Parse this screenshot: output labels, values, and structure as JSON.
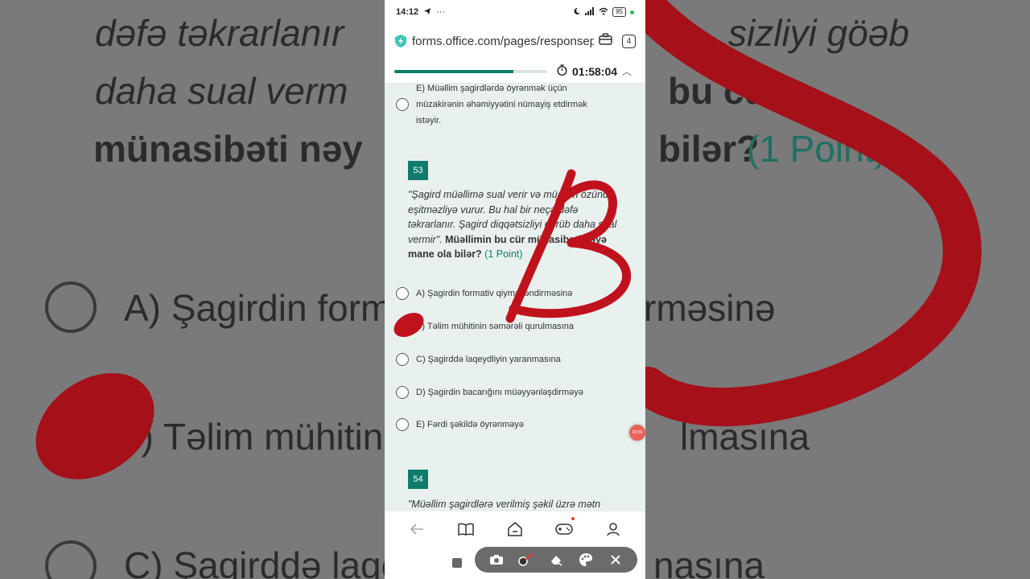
{
  "background_zoom": {
    "line1": "dəfə təkrarlanır",
    "line1b": "sizliyi göəb",
    "line2": "daha sual verm",
    "line2b": "bu cür",
    "line3": "münasibəti nəy",
    "line3b": "bilər?",
    "line3_points": "(1 Point)",
    "optionA": "A) Şagirdin form",
    "optionA_tail": "rməsinə",
    "optionB": "3) Təlim mühitin",
    "optionB_tail": "lmasına",
    "optionC": "C) Şagirddə laqe",
    "optionC_tail": "nasına"
  },
  "status_bar": {
    "time": "14:12",
    "more": "···",
    "battery": "95"
  },
  "browser": {
    "url": "forms.office.com/pages/responsepage",
    "tab_count": "4"
  },
  "form_header": {
    "progress_fraction": 0.78,
    "timer": "01:58:04"
  },
  "prev_question": {
    "option_e_lines": [
      "E) Müəllim şagirdlərdə öyrənmək üçün",
      "müzakirənin əhəmiyyətini nümayiş etdirmək",
      "istəyir."
    ]
  },
  "question_53": {
    "number": "53",
    "text_italic": "\"Şagird müəllimə sual verir və müəllim özünü eşitməzliyə vurur. Bu hal bir neçə dəfə təkrarlanır. Şagird diqqətsizliyi görüb daha sual vermir\".",
    "text_bold": " Müəllimin bu cür münasibəti nəyə mane ola bilər?",
    "points": " (1 Point)",
    "options": [
      "A) Şagirdin formativ qiymətləndirməsinə",
      "B) Təlim mühitinin səmərəli qurulmasına",
      "C) Şagirddə laqeydliyin yaranmasına",
      "D) Şagirdin bacarığını müəyyənləşdirməyə",
      "E) Fərdi şəkildə öyrənməyə"
    ]
  },
  "question_54": {
    "number": "54",
    "text_start": "\"Müəllim şagirdlərə verilmiş şəkil üzrə mətn"
  },
  "recording_badge": "02:59",
  "colors": {
    "accent": "#0e7c6b",
    "scribble": "#c0121c",
    "panel_bg": "#e9f1ef"
  }
}
